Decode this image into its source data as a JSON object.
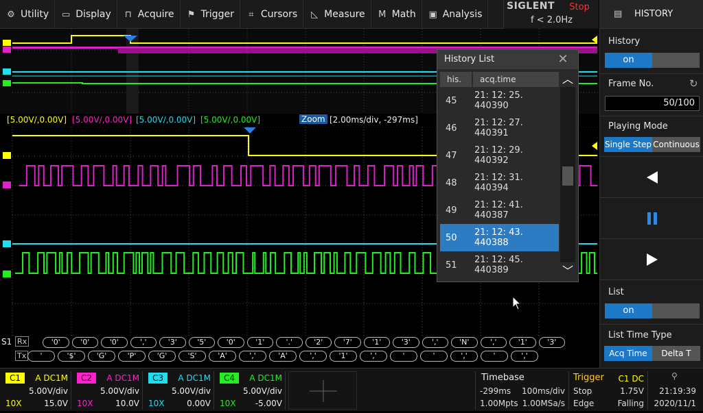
{
  "menu": [
    {
      "label": "Utility",
      "icon": "gear-icon",
      "glyph": "⚙"
    },
    {
      "label": "Display",
      "icon": "monitor-icon",
      "glyph": "▭"
    },
    {
      "label": "Acquire",
      "icon": "acquire-icon",
      "glyph": "⊓"
    },
    {
      "label": "Trigger",
      "icon": "flag-icon",
      "glyph": "⚑"
    },
    {
      "label": "Cursors",
      "icon": "cursors-icon",
      "glyph": "⌗"
    },
    {
      "label": "Measure",
      "icon": "measure-icon",
      "glyph": "◺"
    },
    {
      "label": "Math",
      "icon": "math-icon",
      "glyph": "M"
    },
    {
      "label": "Analysis",
      "icon": "analysis-icon",
      "glyph": "▣"
    }
  ],
  "brand": "SIGLENT",
  "run_state": "Stop",
  "trigger_freq": "f < 2.0Hz",
  "panel": {
    "title": "HISTORY",
    "history_label": "History",
    "history_value": "on",
    "frame_label": "Frame No.",
    "frame_value": "50/100",
    "playing_label": "Playing Mode",
    "mode_single": "Single Step",
    "mode_continuous": "Continuous",
    "list_label": "List",
    "list_value": "on",
    "list_time_label": "List Time Type",
    "time_acq": "Acq Time",
    "time_delta": "Delta T"
  },
  "zoom": {
    "c1": "[5.00V/,0.00V]",
    "c2": "[5.00V/,0.00V]",
    "c3": "[5.00V/,0.00V]",
    "c4": "[5.00V/,0.00V]",
    "tag": "Zoom",
    "timebase": "[2.00ms/div, -297ms]"
  },
  "history_list": {
    "title": "History List",
    "col_index": "his.",
    "col_time": "acq.time",
    "rows": [
      {
        "n": "45",
        "t": "21: 12: 25. 440390"
      },
      {
        "n": "46",
        "t": "21: 12: 27. 440391"
      },
      {
        "n": "47",
        "t": "21: 12: 29. 440392"
      },
      {
        "n": "48",
        "t": "21: 12: 31. 440394"
      },
      {
        "n": "49",
        "t": "21: 12: 41. 440387"
      },
      {
        "n": "50",
        "t": "21: 12: 43. 440388"
      },
      {
        "n": "51",
        "t": "21: 12: 45. 440389"
      }
    ],
    "selected": "50"
  },
  "decode": {
    "bus": "S1",
    "rx_label": "Rx",
    "tx_label": "Tx",
    "rx": [
      "'0'",
      "'0'",
      "'0'",
      "','",
      "'3'",
      "'5'",
      "'0'",
      "'1'",
      "'.'",
      "'2'",
      "'7'",
      "'1'",
      "'3'",
      "','",
      "'N'",
      "','",
      "'1'",
      "'3'"
    ],
    "tx": [
      "'",
      "'$'",
      "'G'",
      "'P'",
      "'G'",
      "'S'",
      "'A'",
      "','",
      "'A'",
      "','",
      "'1'",
      "','",
      "'",
      "'",
      "','",
      "'",
      "','"
    ]
  },
  "channels": [
    {
      "tag": "C1",
      "coupling": "A DC1M",
      "vdiv": "5.00V/div",
      "probe": "10X",
      "offset": "15.0V",
      "color": "#ffff00"
    },
    {
      "tag": "C2",
      "coupling": "A DC1M",
      "vdiv": "5.00V/div",
      "probe": "10X",
      "offset": "10.0V",
      "color": "#ff22cc"
    },
    {
      "tag": "C3",
      "coupling": "A DC1M",
      "vdiv": "5.00V/div",
      "probe": "10X",
      "offset": "0.00V",
      "color": "#22ddee"
    },
    {
      "tag": "C4",
      "coupling": "A DC1M",
      "vdiv": "5.00V/div",
      "probe": "10X",
      "offset": "-5.00V",
      "color": "#22ee22"
    }
  ],
  "timebase": {
    "label": "Timebase",
    "delay": "-299ms",
    "tdiv": "100ms/div",
    "mpts": "1.00Mpts",
    "sa": "1.00MSa/s"
  },
  "trigger": {
    "label": "Trigger",
    "source": "C1 DC",
    "state": "Stop",
    "level": "1.75V",
    "type": "Edge",
    "slope": "Falling"
  },
  "clock": {
    "time": "21:19:39",
    "date": "2020/11/1"
  }
}
